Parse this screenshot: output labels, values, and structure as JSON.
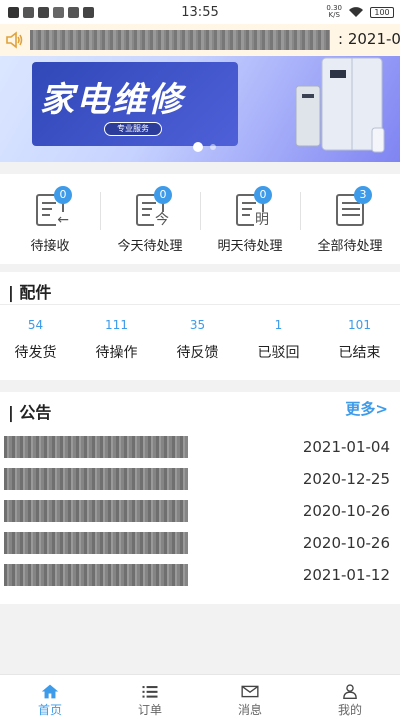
{
  "status_bar": {
    "time": "13:55",
    "speed": "0.30\nK/S",
    "battery": "100"
  },
  "notice_bar": {
    "icon": "speaker-icon",
    "visible_text": ": 2021-0"
  },
  "banner": {
    "title": "家电维修",
    "subtitle": "专业服务"
  },
  "order_status": [
    {
      "label": "待接收",
      "count": "0",
      "glyph": "←",
      "icon": "inbox-doc-icon"
    },
    {
      "label": "今天待处理",
      "count": "0",
      "glyph": "今",
      "icon": "today-doc-icon"
    },
    {
      "label": "明天待处理",
      "count": "0",
      "glyph": "明",
      "icon": "tomorrow-doc-icon"
    },
    {
      "label": "全部待处理",
      "count": "3",
      "glyph": "",
      "icon": "all-doc-icon"
    }
  ],
  "parts": {
    "title": "| 配件",
    "items": [
      {
        "count": "54",
        "label": "待发货"
      },
      {
        "count": "111",
        "label": "待操作"
      },
      {
        "count": "35",
        "label": "待反馈"
      },
      {
        "count": "1",
        "label": "已驳回"
      },
      {
        "count": "101",
        "label": "已结束"
      }
    ]
  },
  "announcements": {
    "title": "| 公告",
    "more": "更多>",
    "items": [
      {
        "date": "2021-01-04"
      },
      {
        "date": "2020-12-25"
      },
      {
        "date": "2020-10-26"
      },
      {
        "date": "2020-10-26"
      },
      {
        "date": "2021-01-12"
      }
    ]
  },
  "bottom_nav": [
    {
      "label": "首页",
      "icon": "home-icon",
      "active": true
    },
    {
      "label": "订单",
      "icon": "list-icon",
      "active": false
    },
    {
      "label": "消息",
      "icon": "mail-icon",
      "active": false
    },
    {
      "label": "我的",
      "icon": "user-icon",
      "active": false
    }
  ],
  "colors": {
    "accent": "#3d9be9",
    "notice_bg": "#fff6e6",
    "banner_dark": "#3048b8"
  }
}
